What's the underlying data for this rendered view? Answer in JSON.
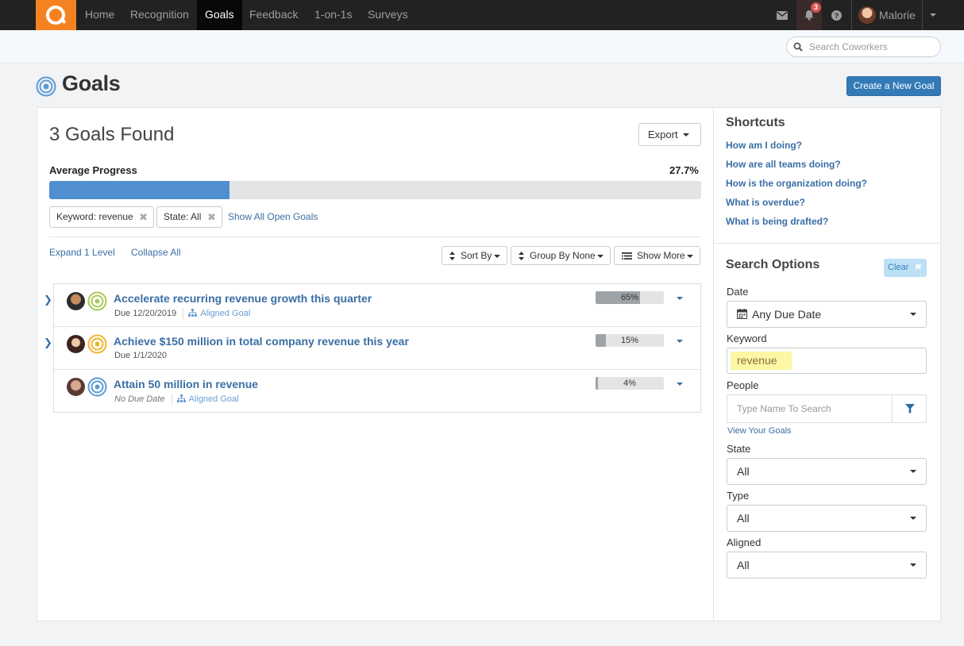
{
  "nav": {
    "items": [
      {
        "label": "Home",
        "active": false
      },
      {
        "label": "Recognition",
        "active": false
      },
      {
        "label": "Goals",
        "active": true
      },
      {
        "label": "Feedback",
        "active": false
      },
      {
        "label": "1-on-1s",
        "active": false
      },
      {
        "label": "Surveys",
        "active": false
      }
    ],
    "notification_count": "3",
    "user_name": "Malorie",
    "icons": [
      "mail-icon",
      "bell-icon",
      "help-icon",
      "chevron-down-icon"
    ]
  },
  "search": {
    "placeholder": "Search Coworkers"
  },
  "page": {
    "title": "Goals",
    "create_button": "Create a New Goal"
  },
  "results": {
    "heading": "3 Goals Found",
    "export_label": "Export",
    "avg_label": "Average Progress",
    "avg_value": "27.7%",
    "avg_fraction": 0.277,
    "filters": [
      {
        "label": "Keyword: revenue"
      },
      {
        "label": "State: All"
      }
    ],
    "show_all_label": "Show All Open Goals",
    "expand_label": "Expand 1 Level",
    "collapse_label": "Collapse All",
    "sort_label": "Sort By",
    "group_label": "Group By None",
    "show_more_label": "Show More"
  },
  "goals": [
    {
      "title": "Accelerate recurring revenue growth this quarter",
      "due": "Due 12/20/2019",
      "aligned": "Aligned Goal",
      "progress_label": "65%",
      "progress": 0.65,
      "expandable": true,
      "target_color": "#a9c957"
    },
    {
      "title": "Achieve $150 million in total company revenue this year",
      "due": "Due 1/1/2020",
      "aligned": "",
      "progress_label": "15%",
      "progress": 0.15,
      "expandable": true,
      "target_color": "#f0b429"
    },
    {
      "title": "Attain 50 million in revenue",
      "due": "No Due Date",
      "aligned": "Aligned Goal",
      "progress_label": "4%",
      "progress": 0.04,
      "expandable": false,
      "target_color": "#5b9bd5"
    }
  ],
  "sidebar": {
    "shortcuts_title": "Shortcuts",
    "shortcuts": [
      "How am I doing?",
      "How are all teams doing?",
      "How is the organization doing?",
      "What is overdue?",
      "What is being drafted?"
    ],
    "search_title": "Search Options",
    "clear_label": "Clear",
    "date_label": "Date",
    "date_value": "Any Due Date",
    "keyword_label": "Keyword",
    "keyword_value": "revenue",
    "people_label": "People",
    "people_placeholder": "Type Name To Search",
    "view_goals_label": "View Your Goals",
    "state_label": "State",
    "state_value": "All",
    "type_label": "Type",
    "type_value": "All",
    "aligned_label": "Aligned",
    "aligned_value": "All"
  },
  "colors": {
    "brand": "#f58220",
    "link": "#3a6ea5",
    "primary": "#337ab7",
    "progress": "#4f8fd0"
  }
}
